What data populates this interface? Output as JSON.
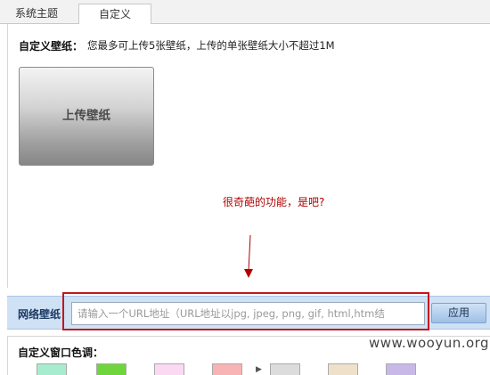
{
  "tabs": [
    {
      "label": "系统主题",
      "active": false
    },
    {
      "label": "自定义",
      "active": true
    }
  ],
  "custom_wallpaper": {
    "label": "自定义壁纸：",
    "description": "您最多可上传5张壁纸，上传的单张壁纸大小不超过1M",
    "upload_button": "上传壁纸"
  },
  "annotation": {
    "text": "很奇葩的功能，是吧?",
    "color": "#b00000"
  },
  "network_wallpaper": {
    "label": "网络壁纸：",
    "placeholder": "请输入一个URL地址（URL地址以jpg, jpeg, png, gif, html,htm结",
    "apply_button": "应用",
    "highlight_color": "#c4161c"
  },
  "window_color": {
    "label": "自定义窗口色调：",
    "swatches": [
      "#a8ecd0",
      "#6ed63c",
      "#fbd9f3",
      "#f8b4b4",
      "#dcdcdc",
      "#efe1c9",
      "#c8b8e8"
    ]
  },
  "watermark": "www.wooyun.org"
}
